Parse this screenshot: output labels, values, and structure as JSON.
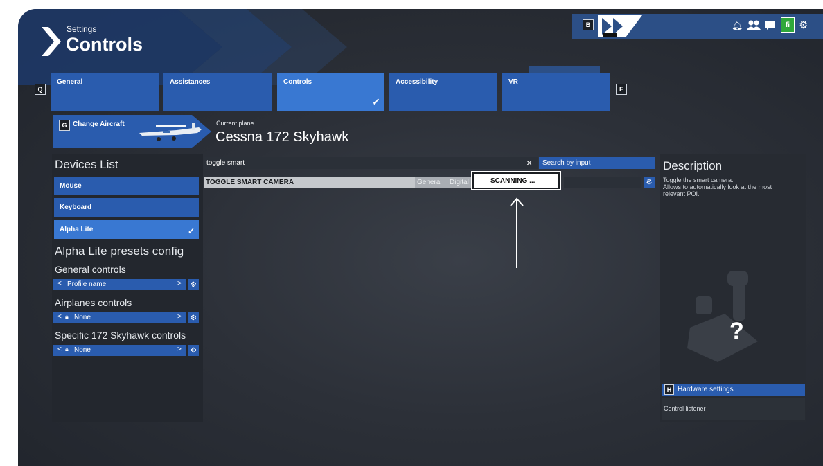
{
  "header": {
    "subtitle": "Settings",
    "title": "Controls",
    "key_b": "B",
    "icons": [
      "bell-icon",
      "friends-icon",
      "chat-icon",
      "marketplace-icon",
      "gear-icon"
    ]
  },
  "tabs": {
    "key_prev": "Q",
    "key_next": "E",
    "items": [
      {
        "label": "General"
      },
      {
        "label": "Assistances"
      },
      {
        "label": "Controls",
        "active": true
      },
      {
        "label": "Accessibility"
      },
      {
        "label": "VR"
      }
    ]
  },
  "aircraft": {
    "key": "G",
    "change_label": "Change Aircraft",
    "current_label": "Current plane",
    "name": "Cessna 172 Skyhawk"
  },
  "devices": {
    "title": "Devices List",
    "items": [
      {
        "label": "Mouse"
      },
      {
        "label": "Keyboard"
      },
      {
        "label": "Alpha Lite",
        "selected": true
      }
    ],
    "presets_title": "Alpha Lite presets config",
    "general_controls": {
      "label": "General controls",
      "value": "Profile name"
    },
    "airplanes_controls": {
      "label": "Airplanes controls",
      "value": "None"
    },
    "specific_controls": {
      "label": "Specific 172 Skyhawk controls",
      "value": "None"
    }
  },
  "search": {
    "value": "toggle smart",
    "clear": "×",
    "mode_button": "Search by input"
  },
  "binding_row": {
    "name": "TOGGLE SMART CAMERA",
    "category": "General",
    "type": "Digital",
    "status": "SCANNING ..."
  },
  "description": {
    "title": "Description",
    "text_line1": "Toggle the smart camera.",
    "text_line2": "Allows to automatically look at the most",
    "text_line3": "relevant POI.",
    "unknown_device": "?",
    "hardware_key": "H",
    "hardware_label": "Hardware settings",
    "control_listener": "Control listener"
  },
  "colors": {
    "accent": "#2a5cae",
    "accent_active": "#3978d2",
    "panel": "#23272e"
  }
}
